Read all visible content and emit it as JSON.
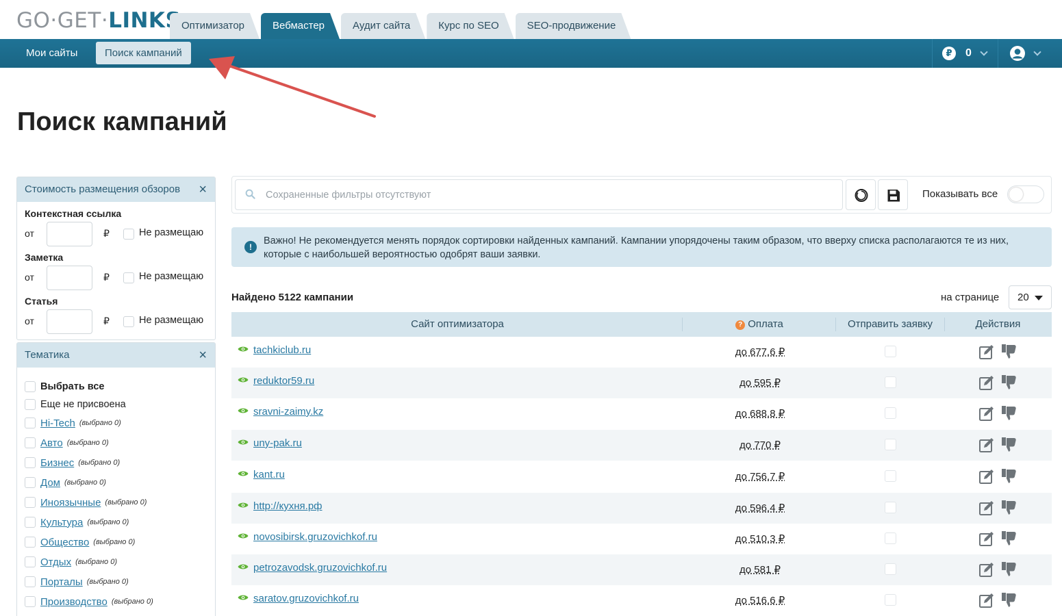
{
  "logo": {
    "part1": "GO·GET·",
    "part2": "LINKS"
  },
  "tabs": [
    "Оптимизатор",
    "Вебмастер",
    "Аудит сайта",
    "Курс по SEO",
    "SEO-продвижение"
  ],
  "nav": {
    "my_sites": "Мои сайты",
    "search_campaigns": "Поиск кампаний",
    "balance": "0",
    "currency_symbol": "₽"
  },
  "page_title": "Поиск кампаний",
  "cost_panel": {
    "title": "Стоимость размещения обзоров",
    "close": "×",
    "rows": [
      {
        "label": "Контекстная ссылка",
        "from": "от",
        "currency": "₽",
        "checkbox_label": "Не размещаю"
      },
      {
        "label": "Заметка",
        "from": "от",
        "currency": "₽",
        "checkbox_label": "Не размещаю"
      },
      {
        "label": "Статья",
        "from": "от",
        "currency": "₽",
        "checkbox_label": "Не размещаю"
      }
    ]
  },
  "topic_panel": {
    "title": "Тематика",
    "close": "×",
    "select_all": "Выбрать все",
    "not_assigned": "Еще не присвоена",
    "items": [
      {
        "name": "Hi-Tech",
        "selected": "(выбрано 0)"
      },
      {
        "name": "Авто",
        "selected": "(выбрано 0)"
      },
      {
        "name": "Бизнес",
        "selected": "(выбрано 0)"
      },
      {
        "name": "Дом",
        "selected": "(выбрано 0)"
      },
      {
        "name": "Иноязычные",
        "selected": "(выбрано 0)"
      },
      {
        "name": "Культура",
        "selected": "(выбрано 0)"
      },
      {
        "name": "Общество",
        "selected": "(выбрано 0)"
      },
      {
        "name": "Отдых",
        "selected": "(выбрано 0)"
      },
      {
        "name": "Порталы",
        "selected": "(выбрано 0)"
      },
      {
        "name": "Производство",
        "selected": "(выбрано 0)"
      }
    ]
  },
  "filters": {
    "placeholder": "Сохраненные фильтры отсутствуют",
    "show_all": "Показывать все"
  },
  "alert": {
    "icon": "!",
    "text": "Важно! Не рекомендуется менять порядок сортировки найденных кампаний. Кампании упорядочены таким образом, что вверху списка располагаются те из них, которые с наибольшей вероятностью одобрят ваши заявки."
  },
  "results": {
    "found": "Найдено 5122 кампании",
    "per_page_label": "на странице",
    "per_page": "20"
  },
  "table": {
    "columns": {
      "site": "Сайт оптимизатора",
      "payment": "Оплата",
      "payment_help": "?",
      "request": "Отправить заявку",
      "actions": "Действия"
    },
    "rows": [
      {
        "site": "tachkiclub.ru",
        "payment": "до 677.6 ₽"
      },
      {
        "site": "reduktor59.ru",
        "payment": "до 595 ₽"
      },
      {
        "site": "sravni-zaimy.kz",
        "payment": "до 688.8 ₽"
      },
      {
        "site": "uny-pak.ru",
        "payment": "до 770 ₽"
      },
      {
        "site": "kant.ru",
        "payment": "до 756.7 ₽"
      },
      {
        "site": "http://кухня.рф",
        "payment": "до 596.4 ₽"
      },
      {
        "site": "novosibirsk.gruzovichkof.ru",
        "payment": "до 510.3 ₽"
      },
      {
        "site": "petrozavodsk.gruzovichkof.ru",
        "payment": "до 581 ₽"
      },
      {
        "site": "saratov.gruzovichkof.ru",
        "payment": "до 516.6 ₽"
      }
    ]
  },
  "colors": {
    "brand": "#1e6f8e",
    "link": "#2a7aa3",
    "panel_head": "#d5e5ed",
    "annotation_arrow": "#d9534f"
  }
}
